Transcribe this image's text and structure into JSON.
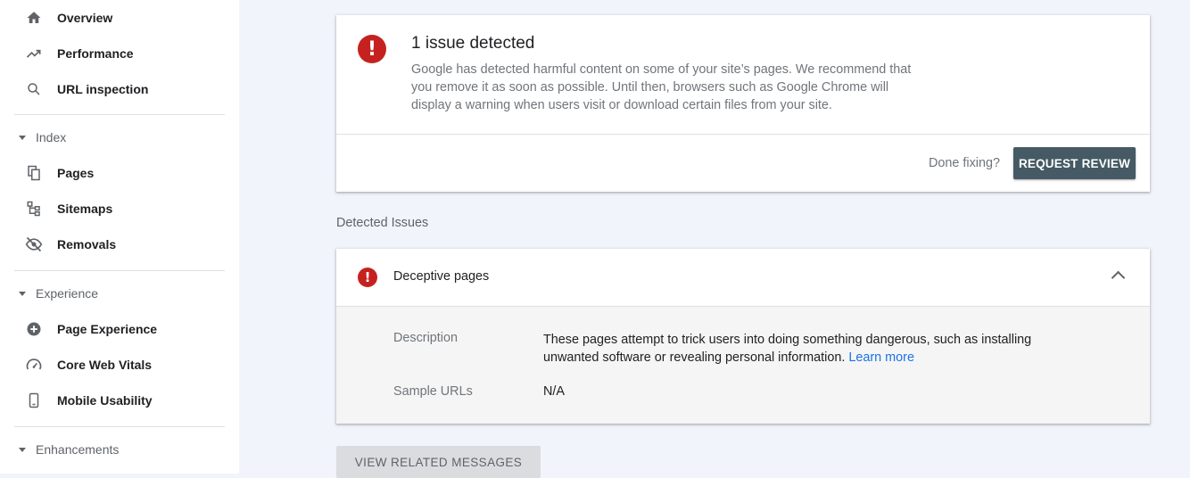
{
  "sidebar": {
    "items": [
      {
        "label": "Overview",
        "icon": "home-icon"
      },
      {
        "label": "Performance",
        "icon": "trending-up-icon"
      },
      {
        "label": "URL inspection",
        "icon": "search-icon"
      }
    ],
    "sections": [
      {
        "label": "Index",
        "items": [
          {
            "label": "Pages",
            "icon": "pages-icon"
          },
          {
            "label": "Sitemaps",
            "icon": "sitemap-icon"
          },
          {
            "label": "Removals",
            "icon": "eye-off-icon"
          }
        ]
      },
      {
        "label": "Experience",
        "items": [
          {
            "label": "Page Experience",
            "icon": "plus-circle-icon"
          },
          {
            "label": "Core Web Vitals",
            "icon": "gauge-icon"
          },
          {
            "label": "Mobile Usability",
            "icon": "phone-icon"
          }
        ]
      },
      {
        "label": "Enhancements",
        "items": []
      }
    ]
  },
  "issue_card": {
    "title": "1 issue detected",
    "text": "Google has detected harmful content on some of your site’s pages. We recommend that you remove it as soon as possible. Until then, browsers such as Google Chrome will display a warning when users visit or download certain files from your site.",
    "done_fixing": "Done fixing?",
    "request_review": "REQUEST REVIEW",
    "icon": "alert-icon",
    "icon_glyph": "!",
    "alert_color": "#c5221f"
  },
  "detected": {
    "heading": "Detected Issues",
    "issue": {
      "title": "Deceptive pages",
      "description_label": "Description",
      "description": "These pages attempt to trick users into doing something dangerous, such as installing unwanted software or revealing personal information.",
      "learn_more": "Learn more",
      "sample_urls_label": "Sample URLs",
      "sample_urls_value": "N/A"
    }
  },
  "view_related": "VIEW RELATED MESSAGES",
  "colors": {
    "accent_button": "#455a64",
    "link": "#1a73e8",
    "background": "#f1f4fb"
  }
}
